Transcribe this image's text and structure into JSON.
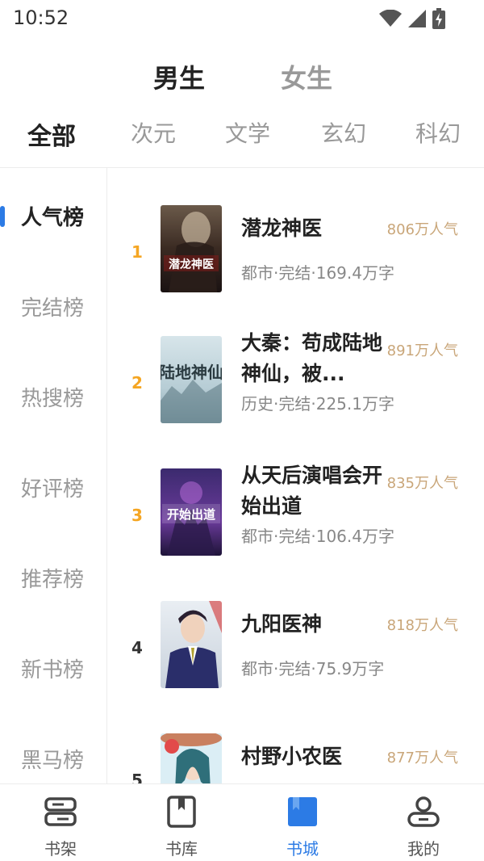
{
  "status": {
    "time": "10:52"
  },
  "gender_tabs": [
    {
      "label": "男生",
      "active": true
    },
    {
      "label": "女生",
      "active": false
    }
  ],
  "category_tabs": [
    {
      "label": "全部",
      "active": true
    },
    {
      "label": "次元",
      "active": false
    },
    {
      "label": "文学",
      "active": false
    },
    {
      "label": "玄幻",
      "active": false
    },
    {
      "label": "科幻",
      "active": false
    }
  ],
  "sidebar": {
    "items": [
      {
        "label": "人气榜",
        "active": true
      },
      {
        "label": "完结榜",
        "active": false
      },
      {
        "label": "热搜榜",
        "active": false
      },
      {
        "label": "好评榜",
        "active": false
      },
      {
        "label": "推荐榜",
        "active": false
      },
      {
        "label": "新书榜",
        "active": false
      },
      {
        "label": "黑马榜",
        "active": false
      }
    ]
  },
  "books": [
    {
      "rank": "1",
      "title": "潜龙神医",
      "popularity": "806万人气",
      "meta": "都市·完结·169.4万字",
      "rank_color": "#f5a623",
      "cover_text": "潜龙神医"
    },
    {
      "rank": "2",
      "title": "大秦：苟成陆地神仙，被...",
      "popularity": "891万人气",
      "meta": "历史·完结·225.1万字",
      "rank_color": "#f5a623",
      "cover_text": "陆地神仙"
    },
    {
      "rank": "3",
      "title": "从天后演唱会开始出道",
      "popularity": "835万人气",
      "meta": "都市·完结·106.4万字",
      "rank_color": "#f5a623",
      "cover_text": "开始出道"
    },
    {
      "rank": "4",
      "title": "九阳医神",
      "popularity": "818万人气",
      "meta": "都市·完结·75.9万字",
      "rank_color": "#333333",
      "cover_text": ""
    },
    {
      "rank": "5",
      "title": "村野小农医",
      "popularity": "877万人气",
      "meta": "",
      "rank_color": "#333333",
      "cover_text": ""
    }
  ],
  "bottom_nav": [
    {
      "label": "书架",
      "icon": "bookshelf-icon",
      "active": false
    },
    {
      "label": "书库",
      "icon": "library-icon",
      "active": false
    },
    {
      "label": "书城",
      "icon": "bookstore-icon",
      "active": true
    },
    {
      "label": "我的",
      "icon": "profile-icon",
      "active": false
    }
  ],
  "colors": {
    "accent": "#2c7be5",
    "popularity": "#c9a679",
    "rank_top": "#f5a623"
  }
}
